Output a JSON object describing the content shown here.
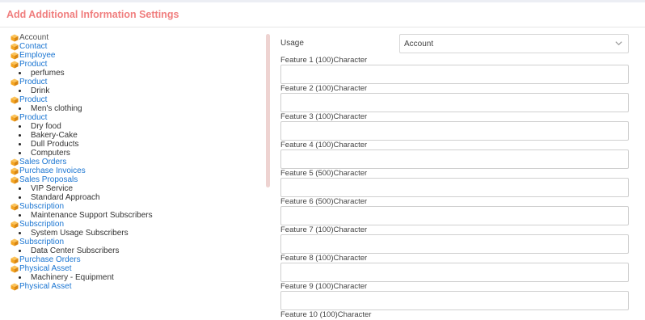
{
  "header": {
    "title": "Add Additional Information Settings"
  },
  "tree": [
    {
      "label": "Account",
      "link": false,
      "children": []
    },
    {
      "label": "Contact",
      "link": true,
      "children": []
    },
    {
      "label": "Employee",
      "link": true,
      "children": []
    },
    {
      "label": "Product",
      "link": true,
      "children": [
        "perfumes"
      ]
    },
    {
      "label": "Product",
      "link": true,
      "children": [
        "Drink"
      ]
    },
    {
      "label": "Product",
      "link": true,
      "children": [
        "Men's clothing"
      ]
    },
    {
      "label": "Product",
      "link": true,
      "children": [
        "Dry food",
        "Bakery-Cake",
        "Dull Products",
        "Computers"
      ]
    },
    {
      "label": "Sales Orders",
      "link": true,
      "children": []
    },
    {
      "label": "Purchase Invoices",
      "link": true,
      "children": []
    },
    {
      "label": "Sales Proposals",
      "link": true,
      "children": [
        "VIP Service",
        "Standard Approach"
      ]
    },
    {
      "label": "Subscription",
      "link": true,
      "children": [
        "Maintenance Support Subscribers"
      ]
    },
    {
      "label": "Subscription",
      "link": true,
      "children": [
        "System Usage Subscribers"
      ]
    },
    {
      "label": "Subscription",
      "link": true,
      "children": [
        "Data Center Subscribers"
      ]
    },
    {
      "label": "Purchase Orders",
      "link": true,
      "children": []
    },
    {
      "label": "Physical Asset",
      "link": true,
      "children": [
        "Machinery - Equipment"
      ]
    },
    {
      "label": "Physical Asset",
      "link": true,
      "children": []
    }
  ],
  "form": {
    "usage_label": "Usage",
    "usage_value": "Account",
    "features": [
      {
        "label": "Feature 1 (100)Character",
        "value": ""
      },
      {
        "label": "Feature 2 (100)Character",
        "value": ""
      },
      {
        "label": "Feature 3 (100)Character",
        "value": ""
      },
      {
        "label": "Feature 4 (100)Character",
        "value": ""
      },
      {
        "label": "Feature 5 (500)Character",
        "value": ""
      },
      {
        "label": "Feature 6 (500)Character",
        "value": ""
      },
      {
        "label": "Feature 7 (100)Character",
        "value": ""
      },
      {
        "label": "Feature 8 (100)Character",
        "value": ""
      },
      {
        "label": "Feature 9 (100)Character",
        "value": ""
      },
      {
        "label": "Feature 10 (100)Character",
        "value": ""
      }
    ]
  },
  "colors": {
    "title": "#f07e7e",
    "link": "#1a75d2",
    "cube_icon": "#f5a623"
  },
  "icons": {
    "tree_node": "cube-icon",
    "select": "chevron-down-icon"
  }
}
